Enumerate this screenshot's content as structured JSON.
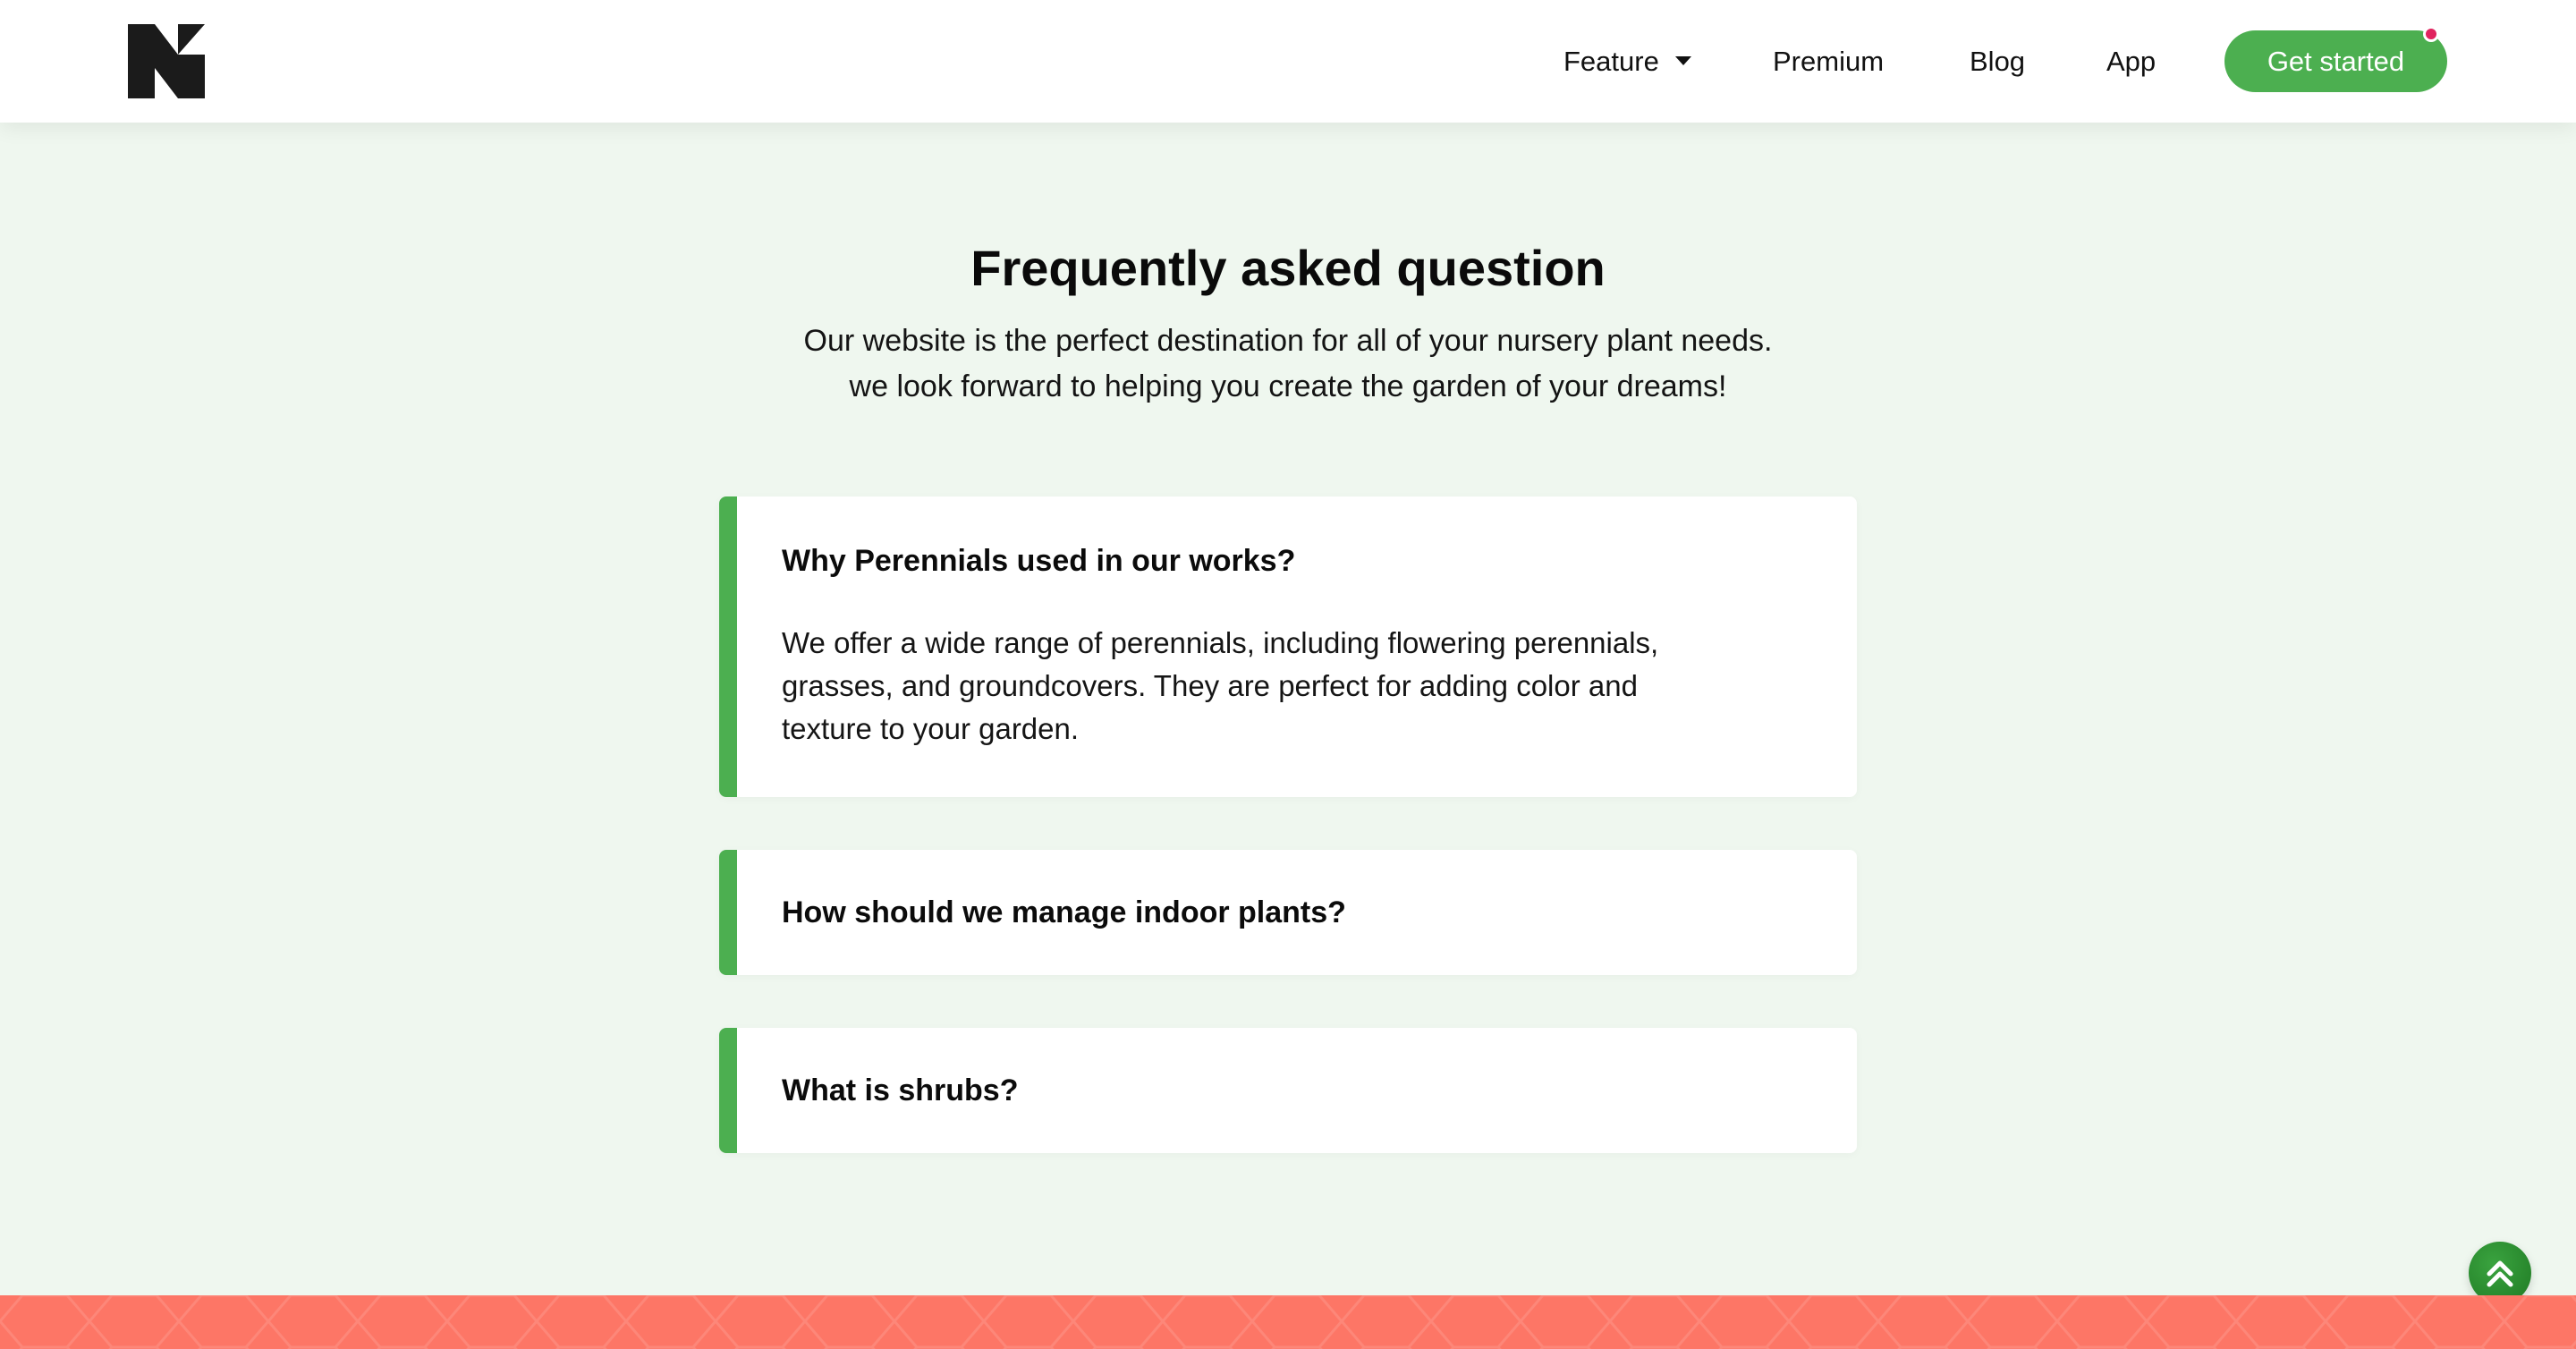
{
  "colors": {
    "accent_green": "#4caf50",
    "page_bg": "#eff7ef",
    "notification_dot": "#e0245e",
    "footer_band": "#fd7666"
  },
  "header": {
    "logo_icon": "n-logo-icon",
    "nav": {
      "feature": "Feature",
      "feature_icon": "caret-down-icon",
      "premium": "Premium",
      "blog": "Blog",
      "app": "App"
    },
    "cta_label": "Get started"
  },
  "faq": {
    "title": "Frequently asked question",
    "subtitle_line1": "Our website is the perfect destination for all of your nursery plant needs.",
    "subtitle_line2": "we look forward to helping you create the garden of your dreams!",
    "items": [
      {
        "question": "Why Perennials used in our works?",
        "answer": "We offer a wide range of perennials, including flowering perennials, grasses, and groundcovers. They are perfect for adding color and texture to your garden.",
        "expanded": true
      },
      {
        "question": "How should we manage indoor plants?",
        "expanded": false
      },
      {
        "question": "What is shrubs?",
        "expanded": false
      }
    ]
  },
  "back_to_top_icon": "double-chevron-up-icon"
}
